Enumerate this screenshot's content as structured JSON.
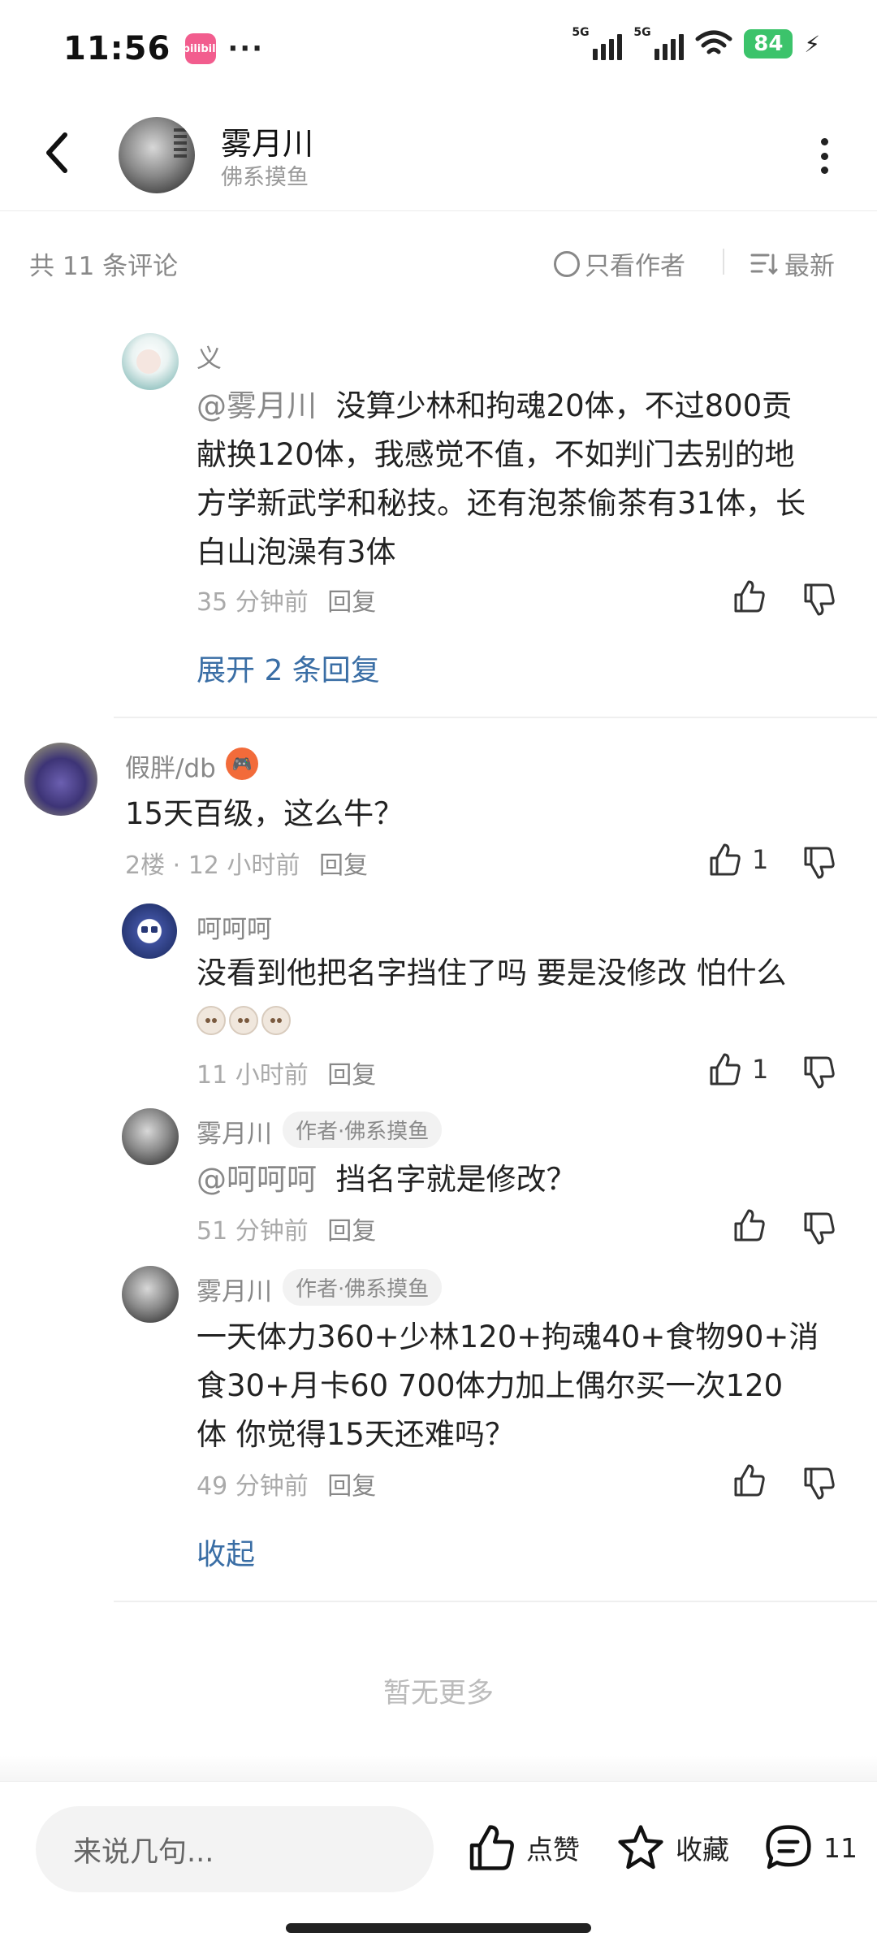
{
  "status_bar": {
    "time": "11:56",
    "app_icon_text": "bilibili",
    "dots": "···",
    "signal1": "5G",
    "signal2": "5G",
    "battery": "84"
  },
  "header": {
    "title": "雾月川",
    "subtitle": "佛系摸鱼"
  },
  "filter": {
    "count": "共 11 条评论",
    "only_author": "只看作者",
    "sort": "最新"
  },
  "comments": [
    {
      "user": "义",
      "mention": "@雾月川",
      "line1": "没算少林和拘魂20体，不过800贡",
      "line2": "献换120体，我感觉不值，不如判门去别的地",
      "line3": "方学新武学和秘技。还有泡茶偷茶有31体，长",
      "line4": "白山泡澡有3体",
      "time": "35 分钟前",
      "reply": "回复",
      "expand": "展开 2 条回复"
    },
    {
      "user": "假胖/db",
      "text": "15天百级，这么牛？",
      "time": "2楼 · 12 小时前",
      "reply": "回复",
      "likes": "1",
      "replies": [
        {
          "user": "呵呵呵",
          "text": "没看到他把名字挡住了吗  要是没修改 怕什么",
          "time": "11 小时前",
          "reply": "回复",
          "likes": "1"
        },
        {
          "user": "雾月川",
          "badge": "作者·佛系摸鱼",
          "mention": "@呵呵呵",
          "text": "挡名字就是修改？",
          "time": "51 分钟前",
          "reply": "回复"
        },
        {
          "user": "雾月川",
          "badge": "作者·佛系摸鱼",
          "line1": "一天体力360+少林120+拘魂40+食物90+消",
          "line2": "食30+月卡60   700体力加上偶尔买一次120",
          "line3": "体 你觉得15天还难吗？",
          "time": "49 分钟前",
          "reply": "回复"
        }
      ],
      "collapse": "收起"
    }
  ],
  "no_more": "暂无更多",
  "bottom_bar": {
    "placeholder": "来说几句...",
    "like_label": "点赞",
    "fav_label": "收藏",
    "comment_count": "11"
  }
}
